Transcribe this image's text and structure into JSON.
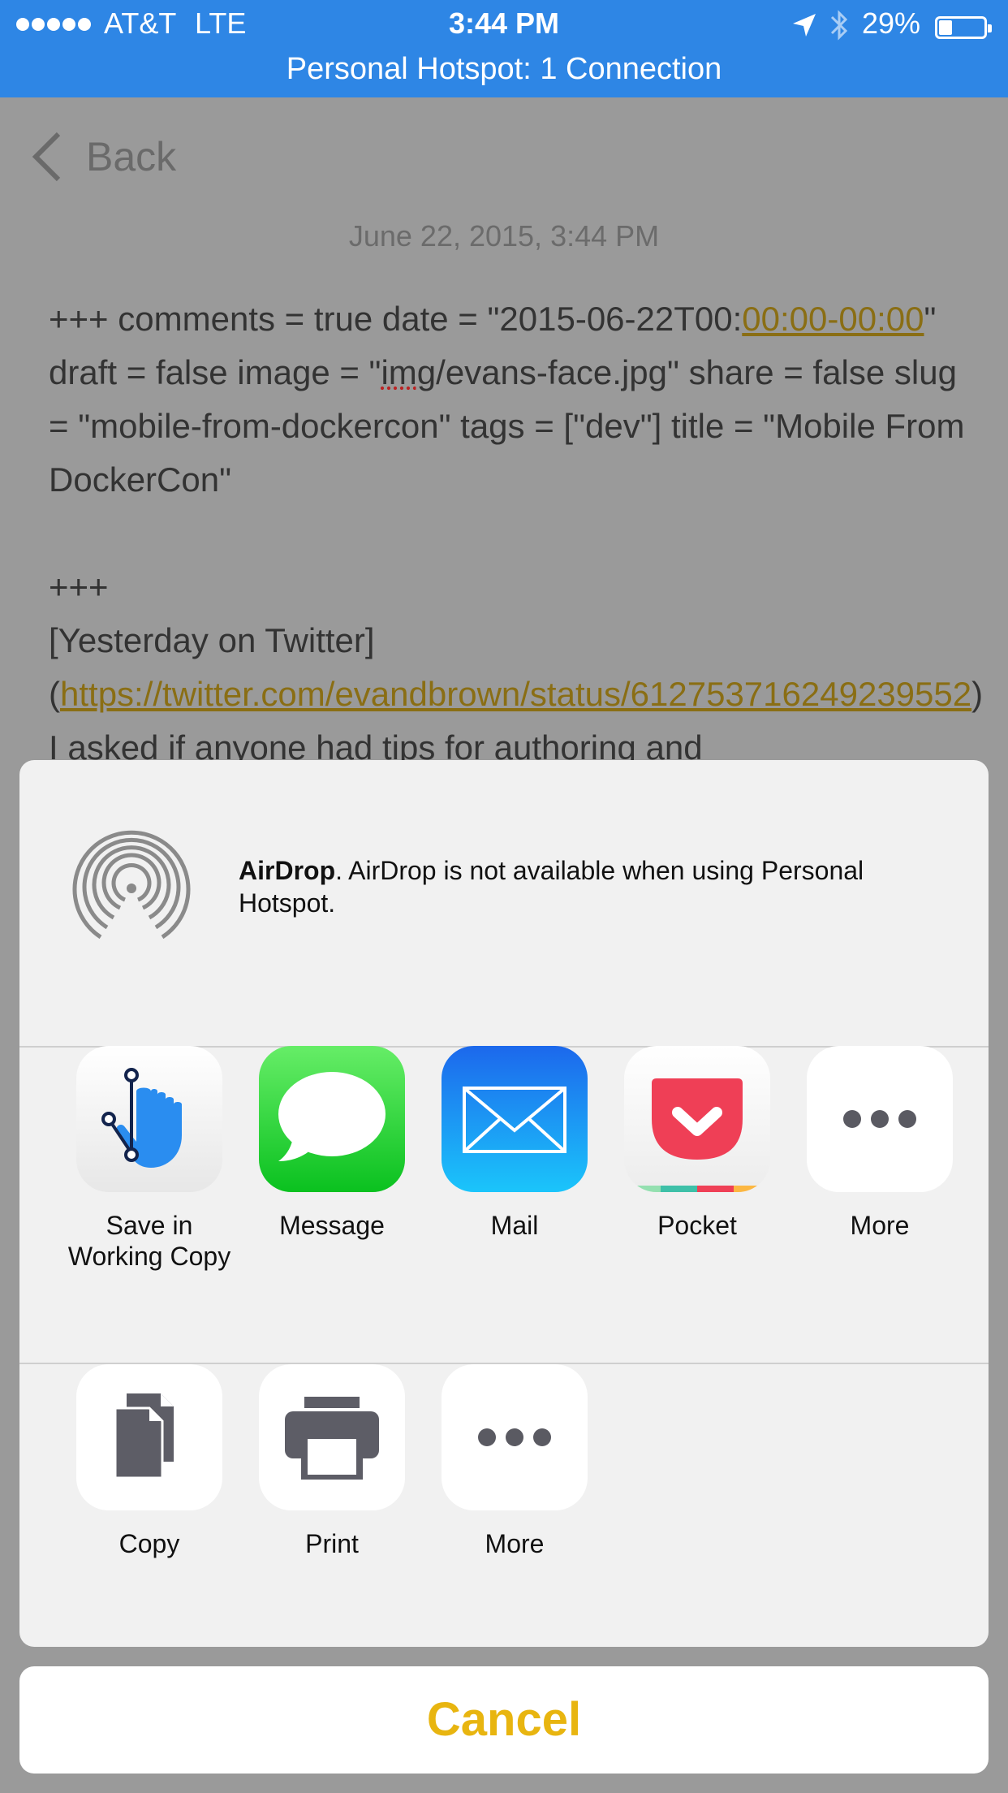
{
  "status_bar": {
    "carrier": "AT&T",
    "network": "LTE",
    "time": "3:44 PM",
    "battery": "29%",
    "battery_level": 0.29,
    "hotspot": "Personal Hotspot: 1 Connection",
    "icons": [
      "signal-dots",
      "location-arrow-icon",
      "bluetooth-icon",
      "battery-icon"
    ]
  },
  "document": {
    "back_label": "Back",
    "date": "June 22, 2015, 3:44 PM",
    "body": {
      "p1_a": "+++ comments = true date = \"2015-06-22T00:",
      "p1_link": "00:00-00:00",
      "p1_b": "\" draft = false image = \"",
      "p1_spell": "img",
      "p1_c": "/evans-face.jpg\" share = false slug = \"mobile-from-dockercon\" tags = [\"dev\"] title = \"Mobile From DockerCon\"",
      "p2": "+++",
      "p3": "[Yesterday on Twitter]",
      "p4_open": "(",
      "p4_link": "https://twitter.com/evandbrown/status/612753716249239552",
      "p4_rest": ") I asked if anyone had tips for authoring and"
    }
  },
  "share_sheet": {
    "airdrop": {
      "title": "AirDrop",
      "message": ". AirDrop is not available when using Personal Hotspot."
    },
    "apps": [
      {
        "label_line1": "Save in",
        "label_line2": "Working Copy",
        "icon": "working-copy-icon"
      },
      {
        "label": "Message",
        "icon": "message-icon"
      },
      {
        "label": "Mail",
        "icon": "mail-icon"
      },
      {
        "label": "Pocket",
        "icon": "pocket-icon"
      },
      {
        "label": "More",
        "icon": "more-icon"
      }
    ],
    "actions": [
      {
        "label": "Copy",
        "icon": "copy-icon"
      },
      {
        "label": "Print",
        "icon": "print-icon"
      },
      {
        "label": "More",
        "icon": "more-icon"
      }
    ],
    "cancel_label": "Cancel"
  },
  "colors": {
    "status_bar": "#2e86e5",
    "accent": "#e8b510",
    "dim_overlay": "#9a9a9a"
  }
}
